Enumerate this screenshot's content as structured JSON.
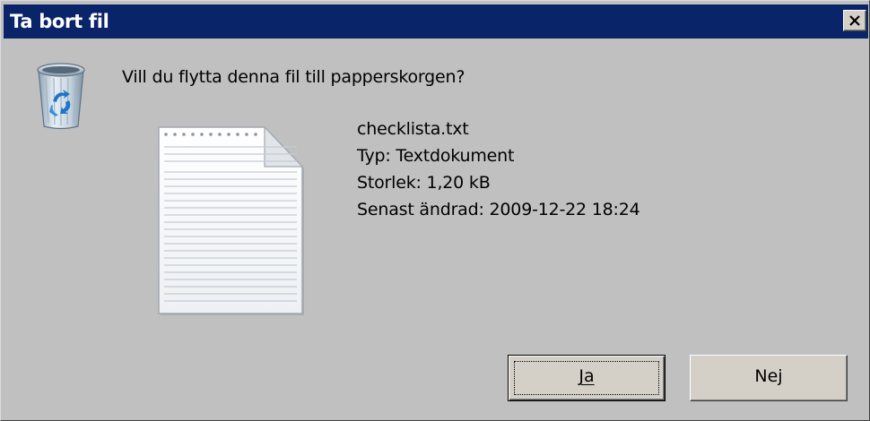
{
  "dialog": {
    "title": "Ta bort fil",
    "close_icon": "close-icon",
    "question": "Vill du flytta denna fil till papperskorgen?",
    "icons": {
      "main": "recycle-bin-icon",
      "file": "text-document-icon"
    }
  },
  "file": {
    "name": "checklista.txt",
    "type": "Typ: Textdokument",
    "size": "Storlek: 1,20 kB",
    "modified": "Senast ändrad: 2009-12-22 18:24"
  },
  "buttons": {
    "yes": "Ja",
    "no": "Nej"
  },
  "colors": {
    "titlebar": "#0a246a",
    "dialog_bg": "#c0c0c0"
  }
}
